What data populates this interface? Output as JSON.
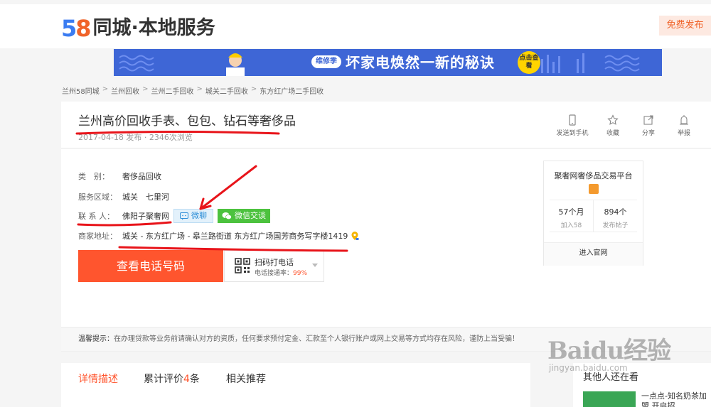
{
  "header": {
    "logo_number_a": "5",
    "logo_number_b": "8",
    "logo_text": "同城·本地服务",
    "post_button": "免费发布"
  },
  "banner": {
    "tag": "维修季",
    "text": "坏家电焕然一新的秘诀",
    "cta": "点击查看"
  },
  "breadcrumb": [
    "兰州58同城",
    "兰州回收",
    "兰州二手回收",
    "城关二手回收",
    "东方红广场二手回收"
  ],
  "breadcrumb_sep": ">",
  "listing": {
    "title": "兰州高价回收手表、包包、钻石等奢侈品",
    "meta": "2017-04-18 发布 · 2346次浏览",
    "actions": {
      "send_phone": "发送到手机",
      "favorite": "收藏",
      "share": "分享",
      "report": "举报"
    }
  },
  "details": {
    "category_label": "类　别：",
    "category_value": "奢侈品回收",
    "area_label": "服务区域：",
    "area_value": "城关　七里河",
    "contact_label": "联 系 人：",
    "contact_value": "佛阳子聚奢网",
    "chat_button": "微聊",
    "wechat_button": "微信交谈",
    "address_label": "商家地址：",
    "address_value": "城关 - 东方红广场 - 皋兰路街道 东方红广场国芳商务写字楼1419",
    "phone_button": "查看电话号码",
    "qr_title": "扫码打电话",
    "qr_rate_label": "电话接通率：",
    "qr_rate_value": "99%"
  },
  "merchant": {
    "name": "聚奢网奢侈品交易平台",
    "stat1_value": "57个月",
    "stat1_caption": "加入58",
    "stat2_value": "894个",
    "stat2_caption": "发布帖子",
    "site_link": "进入官网"
  },
  "notice": {
    "label": "温馨提示：",
    "text": "在办理贷款等业务前请确认对方的资质，任何要求预付定金、汇款至个人银行账户或网上交易等方式均存在风险，谨防上当受骗！"
  },
  "tabs": {
    "detail": "详情描述",
    "reviews_prefix": "累计评价",
    "reviews_count": "4",
    "reviews_suffix": "条",
    "related": "相关推荐"
  },
  "sidebar": {
    "title": "其他人还在看",
    "item_text": "一点点-知名奶茶加盟 开启招"
  },
  "watermark": {
    "big": "Baidu经验",
    "small": "jingyan.baidu.com"
  },
  "colors": {
    "accent": "#ff552e",
    "brand_blue": "#3b7cf1",
    "wechat_green": "#4cc23e",
    "annotation_red": "#e8141a"
  }
}
